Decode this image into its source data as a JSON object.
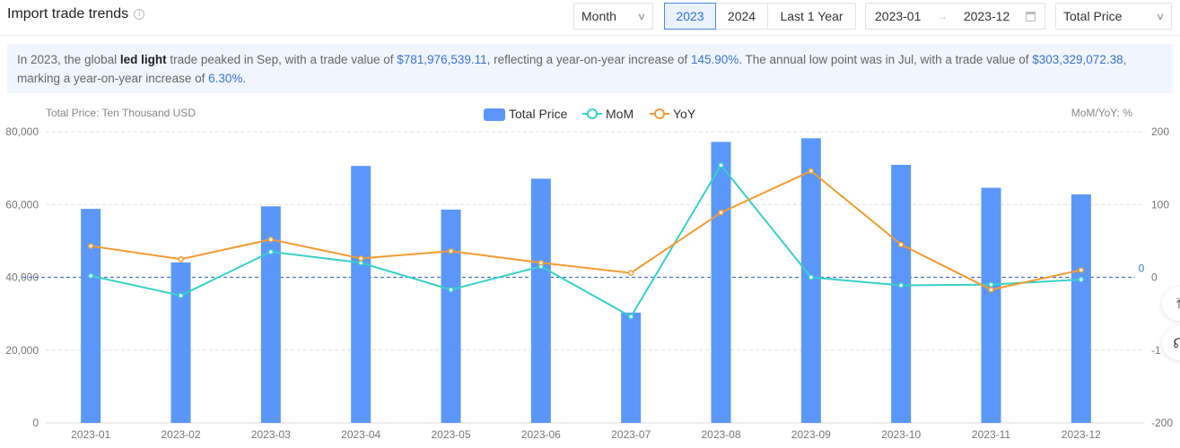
{
  "header": {
    "title": "Import trade trends",
    "info_icon": "info-icon",
    "granularity_select": {
      "value": "Month",
      "icon": "chevron-down-icon"
    },
    "year_tabs": [
      {
        "label": "2023",
        "active": true
      },
      {
        "label": "2024",
        "active": false
      },
      {
        "label": "Last 1 Year",
        "active": false
      }
    ],
    "date_range": {
      "start": "2023-01",
      "separator": "→",
      "end": "2023-12",
      "icon": "calendar-icon"
    },
    "metric_select": {
      "value": "Total Price",
      "icon": "chevron-down-icon"
    }
  },
  "summary": {
    "p1": "In 2023, the global ",
    "product": "led light",
    "p2": " trade peaked in Sep, with a trade value of ",
    "peak_value": "$781,976,539.11",
    "p3": ", reflecting a year-on-year increase of ",
    "peak_yoy": "145.90%",
    "p4": ". The annual low point was in Jul, with a trade value of ",
    "low_value": "$303,329,072.38",
    "p5": ",",
    "p6": "marking a year-on-year increase of ",
    "low_yoy": "6.30%",
    "p7": "."
  },
  "floating_buttons": [
    {
      "name": "back-to-top",
      "glyph": "⤒"
    },
    {
      "name": "customer-service",
      "glyph": "☊"
    }
  ],
  "colors": {
    "bar": "#5b97fb",
    "mom": "#36d1c9",
    "yoy": "#f39b31",
    "markline": "#4a73c4",
    "accent": "#3a73d6"
  },
  "chart_data": {
    "type": "bar",
    "title": "",
    "categories": [
      "2023-01",
      "2023-02",
      "2023-03",
      "2023-04",
      "2023-05",
      "2023-06",
      "2023-07",
      "2023-08",
      "2023-09",
      "2023-10",
      "2023-11",
      "2023-12"
    ],
    "series": [
      {
        "name": "Total Price",
        "type": "bar",
        "axis": "left",
        "values": [
          58800,
          44100,
          59500,
          70600,
          58600,
          67100,
          30300,
          77200,
          78200,
          70900,
          64600,
          62800
        ]
      },
      {
        "name": "MoM",
        "type": "line",
        "axis": "right",
        "values": [
          2,
          -25,
          35,
          20,
          -17,
          15,
          -54,
          154,
          0,
          -11,
          -10,
          -3
        ]
      },
      {
        "name": "YoY",
        "type": "line",
        "axis": "right",
        "values": [
          43,
          25,
          52,
          26,
          36,
          20,
          6,
          89,
          146,
          45,
          -17,
          10
        ]
      }
    ],
    "ylabel": "Total Price: Ten Thousand USD",
    "y2label": "MoM/YoY: %",
    "ylim": [
      0,
      80000
    ],
    "y2lim": [
      -200,
      200
    ],
    "yticks": [
      "0",
      "20,000",
      "40,000",
      "60,000",
      "80,000"
    ],
    "y2ticks": [
      "-200",
      "-1",
      "0",
      "100",
      "200"
    ],
    "markline": {
      "label": "0",
      "value": 0,
      "axis": "right"
    },
    "legend": [
      "Total Price",
      "MoM",
      "YoY"
    ],
    "legend_position": "top-center",
    "grid": true
  }
}
